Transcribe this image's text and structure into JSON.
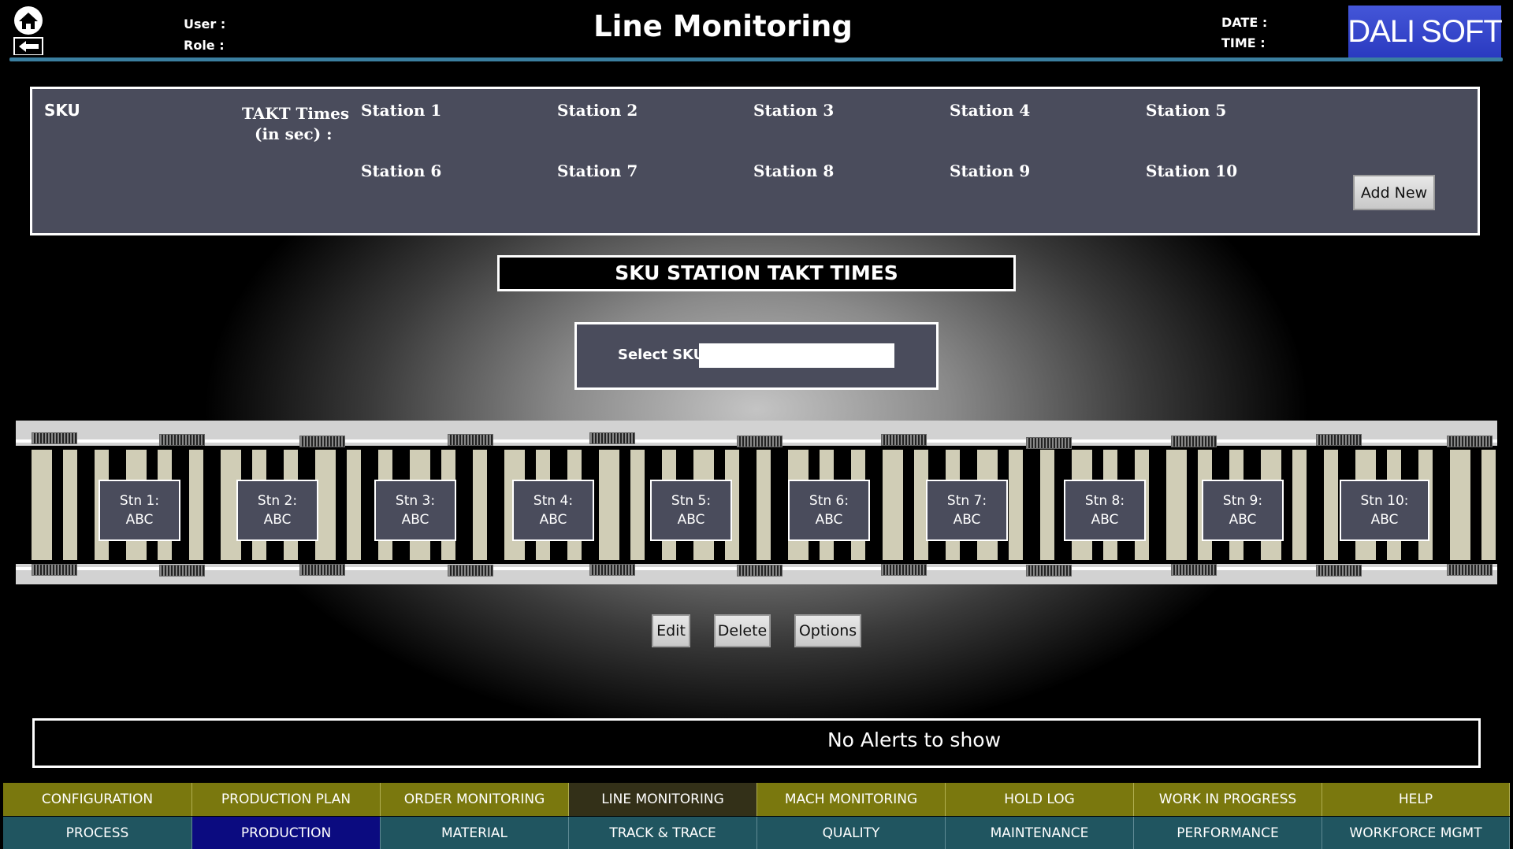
{
  "header": {
    "title": "Line Monitoring",
    "user_label": "User :",
    "role_label": "Role :",
    "date_label": "DATE :",
    "time_label": "TIME :",
    "logo_left": "DALI",
    "logo_right": "SOFT",
    "home_icon": "home-icon",
    "back_icon": "back-arrow-icon"
  },
  "takt_panel": {
    "sku_label": "SKU",
    "takt_label_line1": "TAKT Times",
    "takt_label_line2": "(in sec) :",
    "stations": [
      "Station 1",
      "Station 2",
      "Station 3",
      "Station 4",
      "Station 5",
      "Station 6",
      "Station 7",
      "Station 8",
      "Station 9",
      "Station 10"
    ],
    "add_new_label": "Add New"
  },
  "section_title": "SKU STATION TAKT TIMES",
  "sku_select": {
    "label": "Select SKU:",
    "value": "",
    "placeholder": ""
  },
  "conveyor_stations": [
    {
      "label": "Stn 1:",
      "value": "ABC"
    },
    {
      "label": "Stn 2:",
      "value": "ABC"
    },
    {
      "label": "Stn 3:",
      "value": "ABC"
    },
    {
      "label": "Stn 4:",
      "value": "ABC"
    },
    {
      "label": "Stn 5:",
      "value": "ABC"
    },
    {
      "label": "Stn 6:",
      "value": "ABC"
    },
    {
      "label": "Stn 7:",
      "value": "ABC"
    },
    {
      "label": "Stn 8:",
      "value": "ABC"
    },
    {
      "label": "Stn 9:",
      "value": "ABC"
    },
    {
      "label": "Stn 10:",
      "value": "ABC"
    }
  ],
  "actions": {
    "edit_label": "Edit",
    "delete_label": "Delete",
    "options_label": "Options"
  },
  "alerts": {
    "message": "No Alerts to show"
  },
  "nav_top": [
    "CONFIGURATION",
    "PRODUCTION PLAN",
    "ORDER MONITORING",
    "LINE MONITORING",
    "MACH MONITORING",
    "HOLD LOG",
    "WORK IN PROGRESS",
    "HELP"
  ],
  "nav_bottom": [
    "PROCESS",
    "PRODUCTION",
    "MATERIAL",
    "TRACK & TRACE",
    "QUALITY",
    "MAINTENANCE",
    "PERFORMANCE",
    "WORKFORCE MGMT"
  ],
  "active_nav_top": "LINE MONITORING",
  "active_nav_bottom": "PRODUCTION",
  "colors": {
    "panel": "#4a4c5c",
    "nav_top": "#7a780e",
    "nav_bottom": "#205560",
    "nav_bottom_active": "#0b0b80",
    "header_line": "#3b7fa0",
    "logo_bg": "#3a4bd0"
  }
}
